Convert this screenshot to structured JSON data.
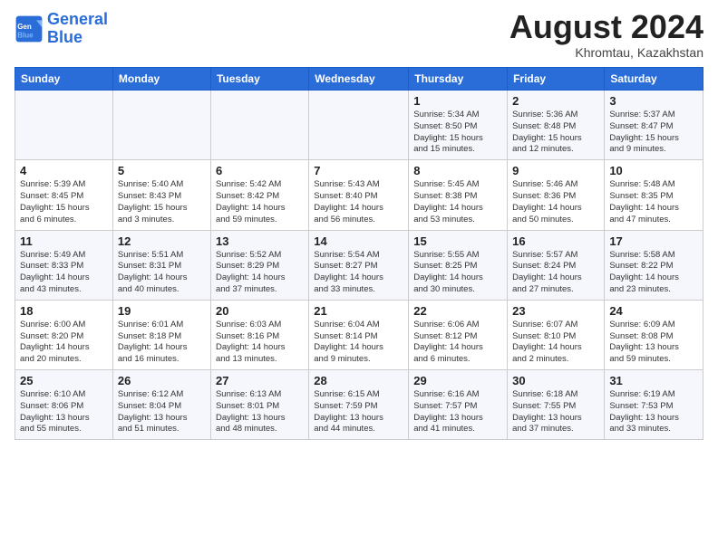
{
  "header": {
    "logo_line1": "General",
    "logo_line2": "Blue",
    "month_title": "August 2024",
    "subtitle": "Khromtau, Kazakhstan"
  },
  "weekdays": [
    "Sunday",
    "Monday",
    "Tuesday",
    "Wednesday",
    "Thursday",
    "Friday",
    "Saturday"
  ],
  "weeks": [
    [
      {
        "day": "",
        "info": ""
      },
      {
        "day": "",
        "info": ""
      },
      {
        "day": "",
        "info": ""
      },
      {
        "day": "",
        "info": ""
      },
      {
        "day": "1",
        "info": "Sunrise: 5:34 AM\nSunset: 8:50 PM\nDaylight: 15 hours\nand 15 minutes."
      },
      {
        "day": "2",
        "info": "Sunrise: 5:36 AM\nSunset: 8:48 PM\nDaylight: 15 hours\nand 12 minutes."
      },
      {
        "day": "3",
        "info": "Sunrise: 5:37 AM\nSunset: 8:47 PM\nDaylight: 15 hours\nand 9 minutes."
      }
    ],
    [
      {
        "day": "4",
        "info": "Sunrise: 5:39 AM\nSunset: 8:45 PM\nDaylight: 15 hours\nand 6 minutes."
      },
      {
        "day": "5",
        "info": "Sunrise: 5:40 AM\nSunset: 8:43 PM\nDaylight: 15 hours\nand 3 minutes."
      },
      {
        "day": "6",
        "info": "Sunrise: 5:42 AM\nSunset: 8:42 PM\nDaylight: 14 hours\nand 59 minutes."
      },
      {
        "day": "7",
        "info": "Sunrise: 5:43 AM\nSunset: 8:40 PM\nDaylight: 14 hours\nand 56 minutes."
      },
      {
        "day": "8",
        "info": "Sunrise: 5:45 AM\nSunset: 8:38 PM\nDaylight: 14 hours\nand 53 minutes."
      },
      {
        "day": "9",
        "info": "Sunrise: 5:46 AM\nSunset: 8:36 PM\nDaylight: 14 hours\nand 50 minutes."
      },
      {
        "day": "10",
        "info": "Sunrise: 5:48 AM\nSunset: 8:35 PM\nDaylight: 14 hours\nand 47 minutes."
      }
    ],
    [
      {
        "day": "11",
        "info": "Sunrise: 5:49 AM\nSunset: 8:33 PM\nDaylight: 14 hours\nand 43 minutes."
      },
      {
        "day": "12",
        "info": "Sunrise: 5:51 AM\nSunset: 8:31 PM\nDaylight: 14 hours\nand 40 minutes."
      },
      {
        "day": "13",
        "info": "Sunrise: 5:52 AM\nSunset: 8:29 PM\nDaylight: 14 hours\nand 37 minutes."
      },
      {
        "day": "14",
        "info": "Sunrise: 5:54 AM\nSunset: 8:27 PM\nDaylight: 14 hours\nand 33 minutes."
      },
      {
        "day": "15",
        "info": "Sunrise: 5:55 AM\nSunset: 8:25 PM\nDaylight: 14 hours\nand 30 minutes."
      },
      {
        "day": "16",
        "info": "Sunrise: 5:57 AM\nSunset: 8:24 PM\nDaylight: 14 hours\nand 27 minutes."
      },
      {
        "day": "17",
        "info": "Sunrise: 5:58 AM\nSunset: 8:22 PM\nDaylight: 14 hours\nand 23 minutes."
      }
    ],
    [
      {
        "day": "18",
        "info": "Sunrise: 6:00 AM\nSunset: 8:20 PM\nDaylight: 14 hours\nand 20 minutes."
      },
      {
        "day": "19",
        "info": "Sunrise: 6:01 AM\nSunset: 8:18 PM\nDaylight: 14 hours\nand 16 minutes."
      },
      {
        "day": "20",
        "info": "Sunrise: 6:03 AM\nSunset: 8:16 PM\nDaylight: 14 hours\nand 13 minutes."
      },
      {
        "day": "21",
        "info": "Sunrise: 6:04 AM\nSunset: 8:14 PM\nDaylight: 14 hours\nand 9 minutes."
      },
      {
        "day": "22",
        "info": "Sunrise: 6:06 AM\nSunset: 8:12 PM\nDaylight: 14 hours\nand 6 minutes."
      },
      {
        "day": "23",
        "info": "Sunrise: 6:07 AM\nSunset: 8:10 PM\nDaylight: 14 hours\nand 2 minutes."
      },
      {
        "day": "24",
        "info": "Sunrise: 6:09 AM\nSunset: 8:08 PM\nDaylight: 13 hours\nand 59 minutes."
      }
    ],
    [
      {
        "day": "25",
        "info": "Sunrise: 6:10 AM\nSunset: 8:06 PM\nDaylight: 13 hours\nand 55 minutes."
      },
      {
        "day": "26",
        "info": "Sunrise: 6:12 AM\nSunset: 8:04 PM\nDaylight: 13 hours\nand 51 minutes."
      },
      {
        "day": "27",
        "info": "Sunrise: 6:13 AM\nSunset: 8:01 PM\nDaylight: 13 hours\nand 48 minutes."
      },
      {
        "day": "28",
        "info": "Sunrise: 6:15 AM\nSunset: 7:59 PM\nDaylight: 13 hours\nand 44 minutes."
      },
      {
        "day": "29",
        "info": "Sunrise: 6:16 AM\nSunset: 7:57 PM\nDaylight: 13 hours\nand 41 minutes."
      },
      {
        "day": "30",
        "info": "Sunrise: 6:18 AM\nSunset: 7:55 PM\nDaylight: 13 hours\nand 37 minutes."
      },
      {
        "day": "31",
        "info": "Sunrise: 6:19 AM\nSunset: 7:53 PM\nDaylight: 13 hours\nand 33 minutes."
      }
    ]
  ]
}
